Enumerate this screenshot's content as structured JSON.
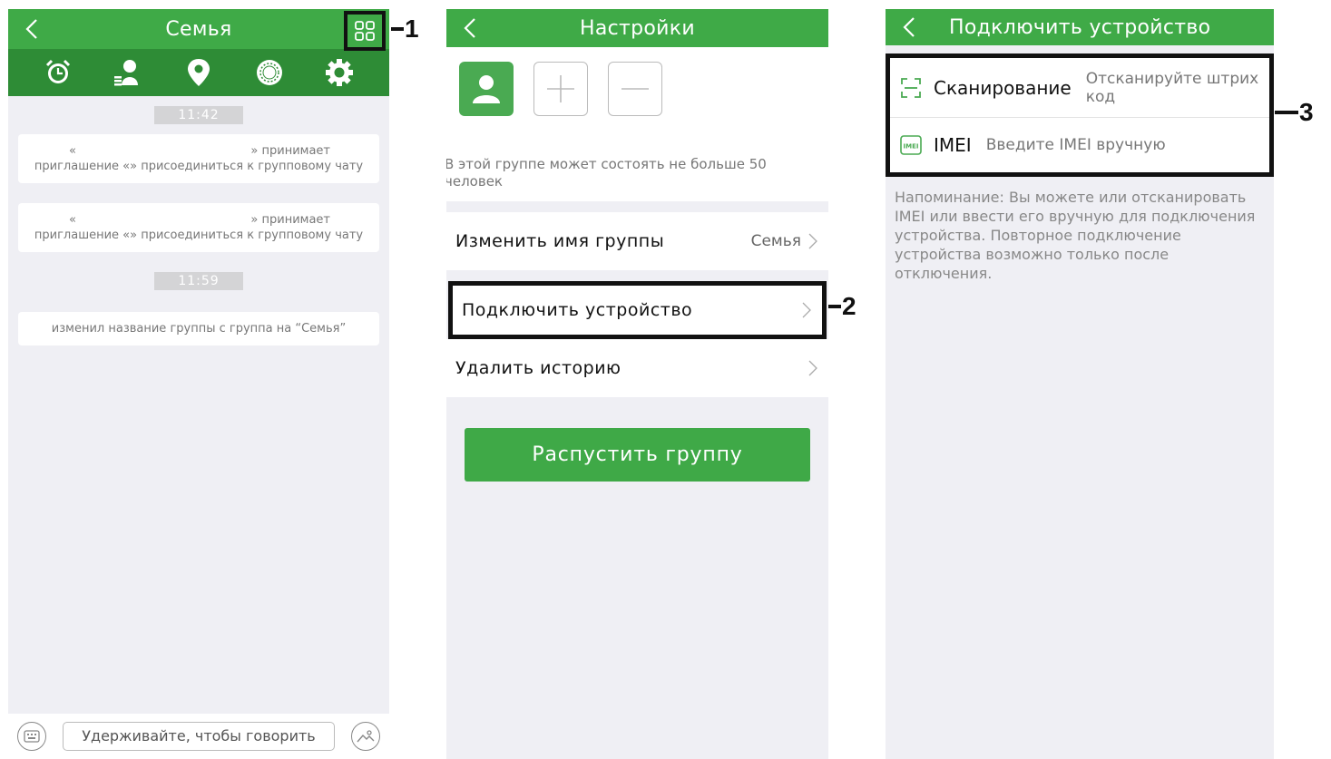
{
  "panel1": {
    "title": "Семья",
    "icon_bar": [
      "alarm-icon",
      "contacts-icon",
      "location-icon",
      "target-icon",
      "settings-icon"
    ],
    "timestamps": [
      "11:42",
      "11:59"
    ],
    "messages": [
      {
        "line1_left": "«",
        "line1_right": "» принимает",
        "line2": "приглашение «» присоединиться к групповому чату"
      },
      {
        "line1_left": "«",
        "line1_right": "» принимает",
        "line2": "приглашение «» присоединиться к групповому чату"
      }
    ],
    "rename_message": "изменил название группы с группа на “Семья”",
    "hold_to_talk": "Удерживайте, чтобы говорить"
  },
  "panel2": {
    "title": "Настройки",
    "members_hint": "В этой группе может состоять не больше 50 человек",
    "rows": {
      "rename_label": "Изменить имя группы",
      "rename_value": "Семья",
      "connect_label": "Подключить устройство",
      "clear_label": "Удалить историю"
    },
    "dissolve_label": "Распустить группу"
  },
  "panel3": {
    "title": "Подключить устройство",
    "scan_title": "Сканирование",
    "scan_desc": "Отсканируйте штрих код",
    "imei_title": "IMEI",
    "imei_icon_text": "IMEI",
    "imei_desc": "Введите IMEI вручную",
    "reminder": "Напоминание: Вы можете или отсканировать IMEI или ввести его вручную для подключения устройства. Повторное подключение устройства возможно только после отключения."
  },
  "callouts": [
    "1",
    "2",
    "3"
  ],
  "colors": {
    "brand_green": "#3faa47",
    "dark_green": "#2e8c36",
    "background": "#efeff4"
  }
}
